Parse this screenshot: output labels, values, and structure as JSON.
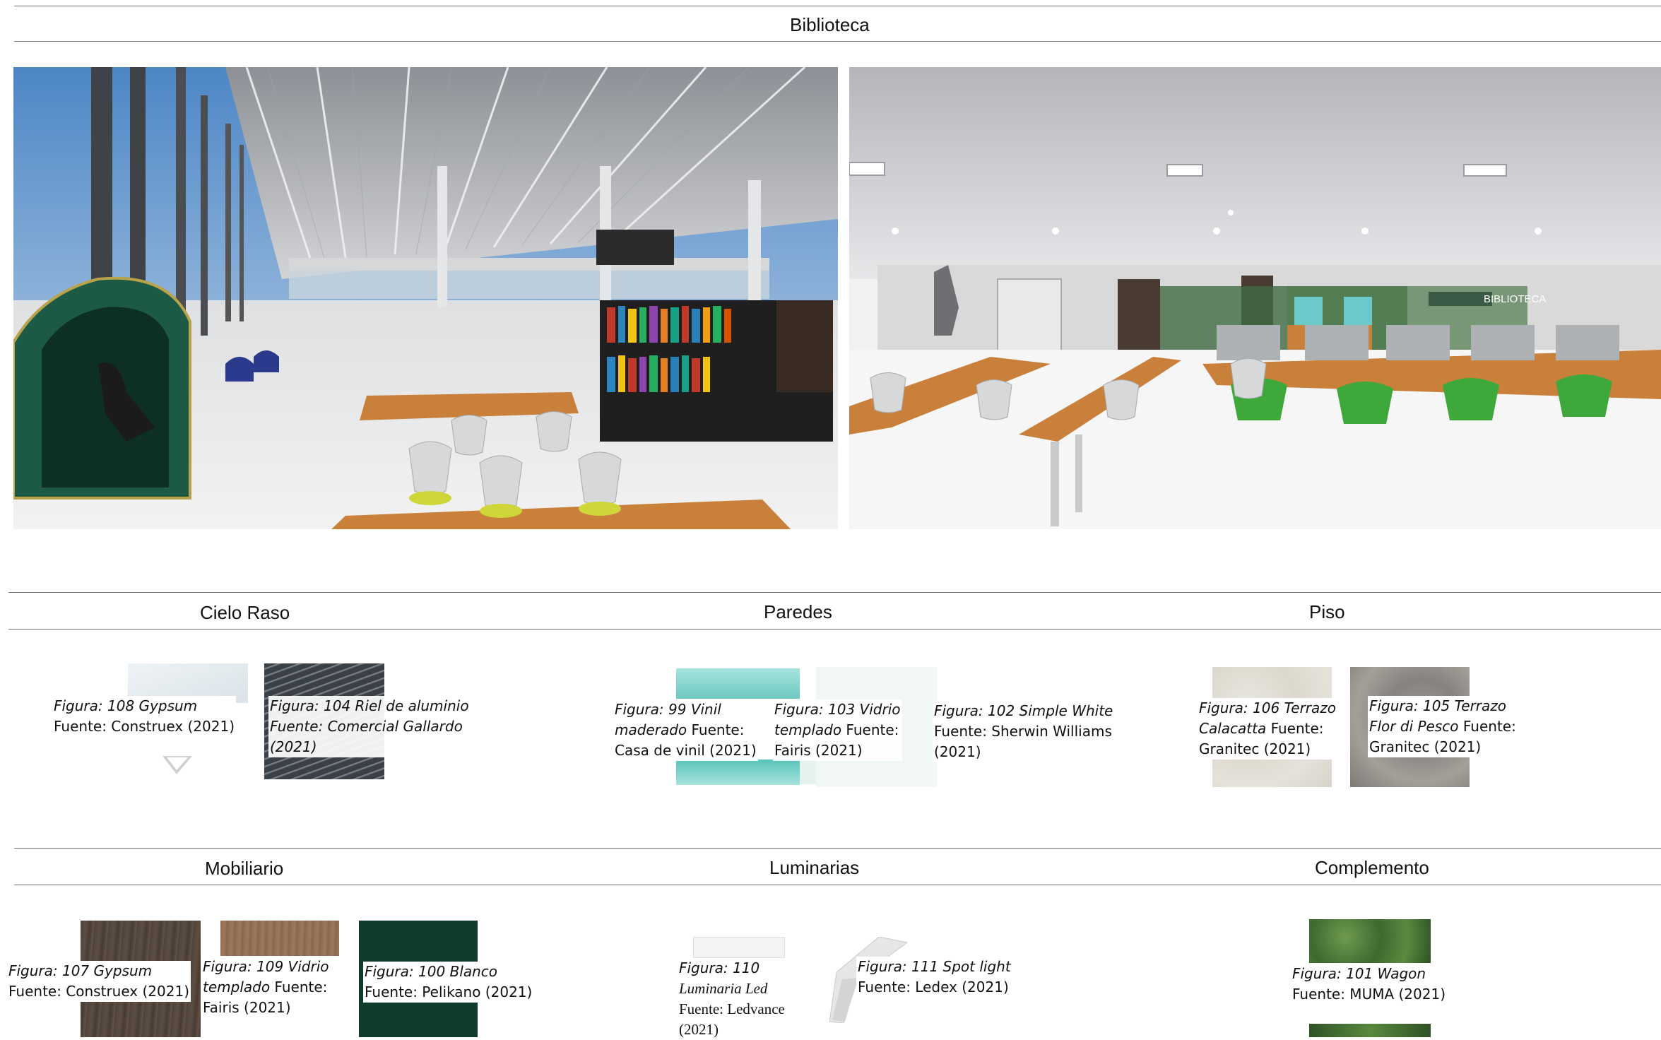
{
  "header": {
    "title": "Biblioteca"
  },
  "renders": [
    {
      "name": "render-left"
    },
    {
      "name": "render-right",
      "sign_text": "BIBLIOTECA"
    }
  ],
  "sections": {
    "cielo_raso": "Cielo Raso",
    "paredes": "Paredes",
    "piso": "Piso",
    "mobiliario": "Mobiliario",
    "luminarias": "Luminarias",
    "complemento": "Complemento"
  },
  "captions": {
    "fig108": {
      "italic": "Figura: 108 Gypsum",
      "plain": "Fuente: Construex (2021)"
    },
    "fig104": {
      "italic": "Figura: 104 Riel de aluminio",
      "italic2": "Fuente: Comercial Gallardo",
      "italic3": "(2021)"
    },
    "fig99": {
      "italic1": "Figura: 99 Vinil",
      "italic2": "maderado",
      "plain2": " Fuente:",
      "plain3": "Casa de vinil (2021)"
    },
    "fig103": {
      "italic1": "Figura: 103 Vidrio",
      "italic2": "templado",
      "plain2": " Fuente:",
      "plain3": "Fairis (2021)"
    },
    "fig102": {
      "italic": "Figura: 102 Simple White",
      "plain2": "Fuente: Sherwin Williams",
      "plain3": "(2021)"
    },
    "fig106": {
      "italic1": "Figura: 106 Terrazo",
      "italic2": "Calacatta",
      "plain2": " Fuente:",
      "plain3": "Granitec (2021)"
    },
    "fig105": {
      "italic1": "Figura: 105 Terrazo",
      "italic2": "Flor di Pesco",
      "plain2": " Fuente:",
      "plain3": "Granitec (2021)"
    },
    "fig107": {
      "italic": "Figura: 107 Gypsum",
      "plain": "Fuente: Construex (2021)"
    },
    "fig109": {
      "italic1": "Figura: 109 Vidrio",
      "italic2": "templado",
      "plain2": " Fuente:",
      "plain3": "Fairis (2021)"
    },
    "fig100": {
      "italic": "Figura: 100 Blanco",
      "plain": "Fuente: Pelikano (2021)"
    },
    "fig110": {
      "italic1": "Figura: 110",
      "italic2": "Luminaria Led",
      "plain3": "Fuente: Ledvance",
      "plain4": "(2021)"
    },
    "fig111": {
      "italic": "Figura: 111 Spot light",
      "plain": "Fuente: Ledex (2021)"
    },
    "fig101": {
      "italic": "Figura: 101 Wagon",
      "plain": "Fuente: MUMA (2021)"
    }
  },
  "colors": {
    "rule": "#6d6d6d",
    "wood": "#c8803a",
    "green_pod": "#1d5a46",
    "chair_green": "#3fa83a",
    "dark_green_swatch": "#0f3a2e"
  }
}
